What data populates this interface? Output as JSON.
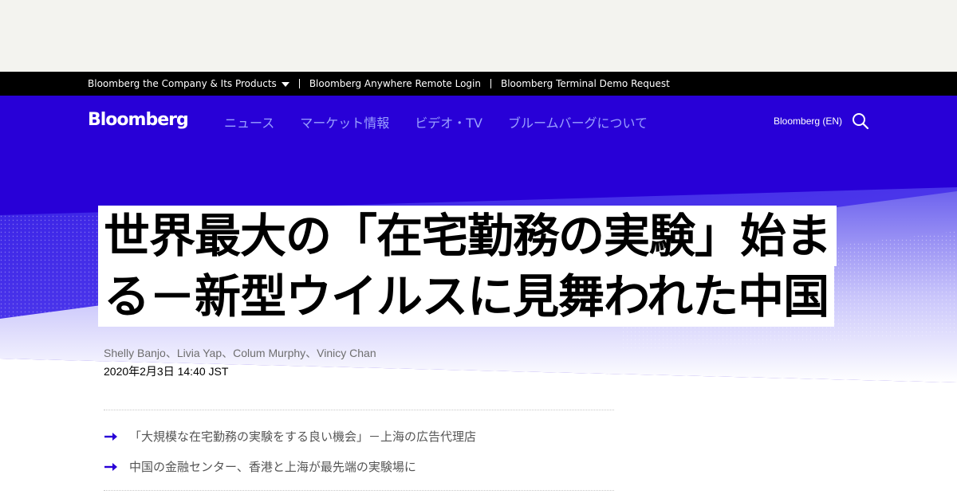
{
  "corporate_bar": {
    "items": [
      "Bloomberg the Company & Its Products",
      "Bloomberg Anywhere Remote Login",
      "Bloomberg Terminal Demo Request"
    ]
  },
  "header": {
    "logo": "Bloomberg",
    "nav": [
      "ニュース",
      "マーケット情報",
      "ビデオ・TV",
      "ブルームバーグについて"
    ],
    "edition": "Bloomberg (EN)",
    "search_icon": "search-icon"
  },
  "article": {
    "headline_lines": [
      "世界最大の「在宅勤務の実験」始ま",
      "る－新型ウイルスに見舞われた中国"
    ],
    "authors": "Shelly Banjo、Livia Yap、Colum Murphy、Vinicy Chan",
    "timestamp": "2020年2月3日 14:40 JST",
    "related": [
      "「大規模な在宅勤務の実験をする良い機会」－上海の広告代理店",
      "中国の金融センター、香港と上海が最先端の実験場に"
    ]
  },
  "colors": {
    "brand_blue": "#2800d7",
    "corp_bar": "#000000",
    "ad_background": "#f3f3ef"
  }
}
